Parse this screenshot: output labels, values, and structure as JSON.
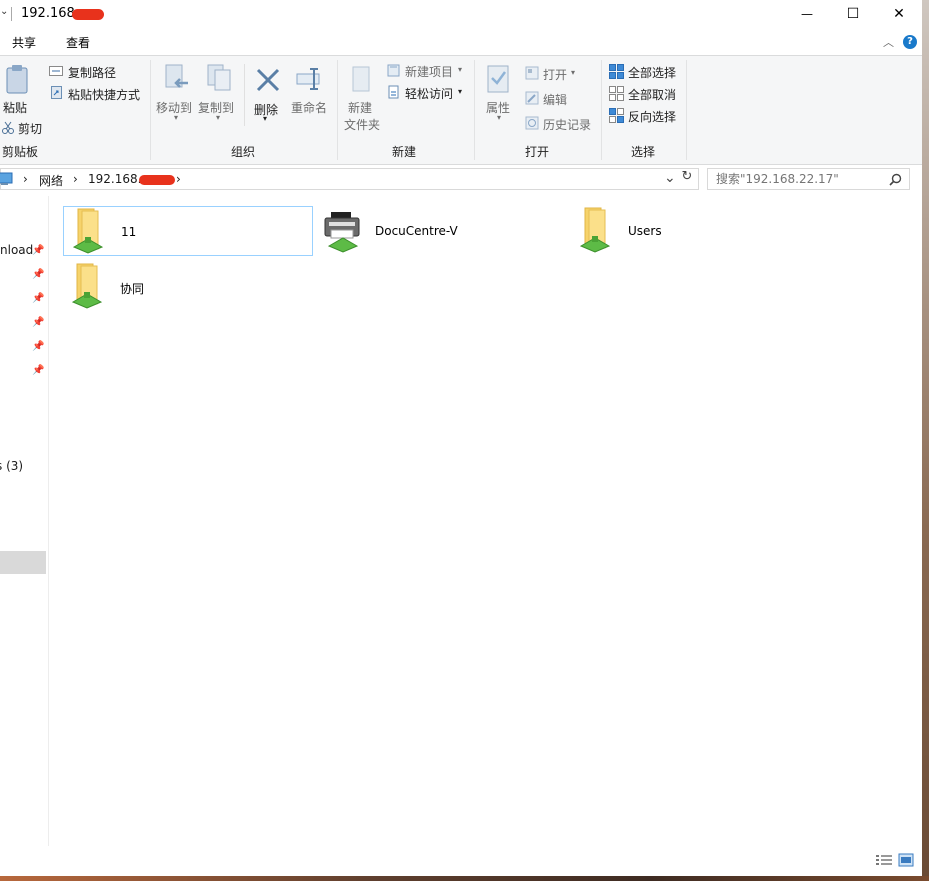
{
  "title": {
    "text": "192.168.",
    "caret": "⌄"
  },
  "window_controls": {
    "minimize": "—",
    "maximize": "☐",
    "close": "✕"
  },
  "tabs": [
    "共享",
    "查看"
  ],
  "help": "?",
  "ribbon": {
    "clipboard": {
      "label": "剪贴板",
      "paste": "粘贴",
      "cut": "剪切",
      "copy_path": "复制路径",
      "paste_shortcut": "粘贴快捷方式"
    },
    "organize": {
      "label": "组织",
      "move_to": "移动到",
      "copy_to": "复制到",
      "delete": "删除",
      "rename": "重命名"
    },
    "new": {
      "label": "新建",
      "new_folder_line1": "新建",
      "new_folder_line2": "文件夹",
      "new_item": "新建项目",
      "easy_access": "轻松访问"
    },
    "open": {
      "label": "打开",
      "properties": "属性",
      "open": "打开",
      "edit": "编辑",
      "history": "历史记录"
    },
    "select": {
      "label": "选择",
      "select_all": "全部选择",
      "select_none": "全部取消",
      "invert": "反向选择"
    }
  },
  "address": {
    "segments": [
      "网络",
      "192.168."
    ],
    "separator": "›"
  },
  "search": {
    "placeholder": "搜索\"192.168.22.17\""
  },
  "nav": {
    "items": [
      "nload",
      "",
      "",
      "",
      "",
      ""
    ],
    "group_count": "s (3)"
  },
  "items": [
    {
      "name": "11",
      "type": "network-folder",
      "selected": true
    },
    {
      "name": "DocuCentre-V",
      "type": "network-printer",
      "selected": false
    },
    {
      "name": "Users",
      "type": "network-folder",
      "selected": false
    },
    {
      "name": "协同",
      "type": "network-folder",
      "selected": false
    }
  ]
}
